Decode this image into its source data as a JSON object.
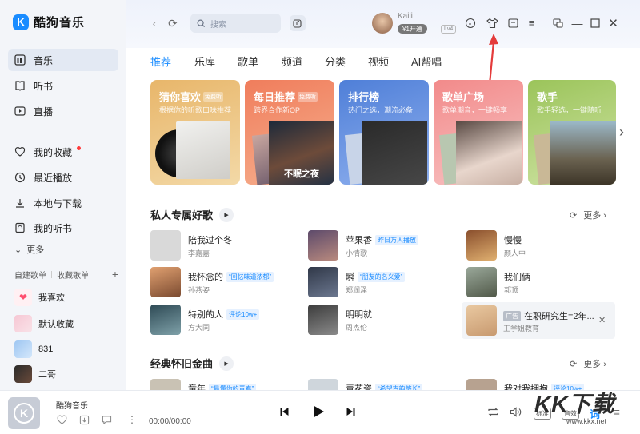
{
  "app": {
    "logo_letter": "K",
    "name": "酷狗音乐"
  },
  "sidebar": {
    "nav": [
      {
        "label": "音乐",
        "icon": "music-library-icon",
        "active": true
      },
      {
        "label": "听书",
        "icon": "book-icon"
      },
      {
        "label": "直播",
        "icon": "live-icon"
      },
      {
        "label": "我的收藏",
        "icon": "heart-icon",
        "has_dot": true
      },
      {
        "label": "最近播放",
        "icon": "clock-icon"
      },
      {
        "label": "本地与下载",
        "icon": "download-icon"
      },
      {
        "label": "我的听书",
        "icon": "headphone-book-icon"
      }
    ],
    "more_label": "更多",
    "playlist_tabs": {
      "created": "自建歌单",
      "collected": "收藏歌单",
      "add": "+"
    },
    "playlists": [
      {
        "label": "我喜欢",
        "color": "#ffe8ec"
      },
      {
        "label": "默认收藏",
        "color": "#f6c7d4"
      },
      {
        "label": "831",
        "color": "#9ec6f2"
      },
      {
        "label": "二哥",
        "color": "#2b2b2b"
      }
    ]
  },
  "header": {
    "search_placeholder": "搜索",
    "user": {
      "name": "Kaili",
      "vip": "¥1开通",
      "level": "Lv4"
    }
  },
  "tabs": [
    "推荐",
    "乐库",
    "歌单",
    "频道",
    "分类",
    "视频",
    "AI帮唱"
  ],
  "cards": [
    {
      "title": "猜你喜欢",
      "tag": "免费听",
      "sub": "根据你的听歌口味推荐",
      "color_from": "#e8b66a",
      "color_to": "#f3d9a7"
    },
    {
      "title": "每日推荐",
      "tag": "免费听",
      "sub": "跨界合作新OP",
      "color_from": "#f07d5c",
      "color_to": "#f6b08e",
      "art_text": "不眠之夜"
    },
    {
      "title": "排行榜",
      "tag": "",
      "sub": "热门之选，潮流必备",
      "color_from": "#4f7fd8",
      "color_to": "#8fb0ee"
    },
    {
      "title": "歌单广场",
      "tag": "",
      "sub": "歌单潮音，一键畅享",
      "color_from": "#f28a8a",
      "color_to": "#f8c3c3"
    },
    {
      "title": "歌手",
      "tag": "",
      "sub": "歌手轻选，一键随听",
      "color_from": "#9bc45a",
      "color_to": "#cfe3a4"
    }
  ],
  "section1": {
    "title": "私人专属好歌",
    "more": "更多",
    "songs": [
      {
        "title": "陪我过个冬",
        "tag": "",
        "artist": "李嘉嘉",
        "thumb": "#d9d9d9"
      },
      {
        "title": "苹果香",
        "tag": "昨日万人播放",
        "artist": "小情歌",
        "thumb": "#5d4a6b"
      },
      {
        "title": "慢慢",
        "tag": "",
        "artist": "颜人中",
        "thumb": "#8a4f2d"
      },
      {
        "title": "我怀念的",
        "tag": "“回忆味道浓郁”",
        "artist": "孙燕姿",
        "thumb": "#e0a070"
      },
      {
        "title": "瞬",
        "tag": "“朋友的名义爱”",
        "artist": "郑润泽",
        "thumb": "#303848"
      },
      {
        "title": "我们俩",
        "tag": "",
        "artist": "郭顶",
        "thumb": "#9aa89a"
      },
      {
        "title": "特别的人",
        "tag": "评论10w+",
        "artist": "方大同",
        "thumb": "#2e4a55"
      },
      {
        "title": "明明就",
        "tag": "",
        "artist": "周杰伦",
        "thumb": "#3c3c3c"
      }
    ],
    "ad": {
      "tag": "广告",
      "title": "在职研究生=2年...",
      "sub": "王学姐教育",
      "thumb": "#e9c8a0"
    }
  },
  "section2": {
    "title": "经典怀旧金曲",
    "more": "更多",
    "songs": [
      {
        "title": "童年",
        "tag": "“最懂你的青春”",
        "thumb": "#c9c2b4"
      },
      {
        "title": "青花瓷",
        "tag": "“希望古韵悠长”",
        "thumb": "#cfd6dc"
      },
      {
        "title": "我对我拥抱",
        "tag": "评论10w+",
        "thumb": "#b7a290"
      }
    ]
  },
  "player": {
    "title": "酷狗音乐",
    "time": "00:00/00:00",
    "std_label": "标准",
    "effect_label": "音效",
    "lyrics_label": "词"
  },
  "watermark": {
    "text": "KK下载",
    "url": "www.kkx.net"
  }
}
